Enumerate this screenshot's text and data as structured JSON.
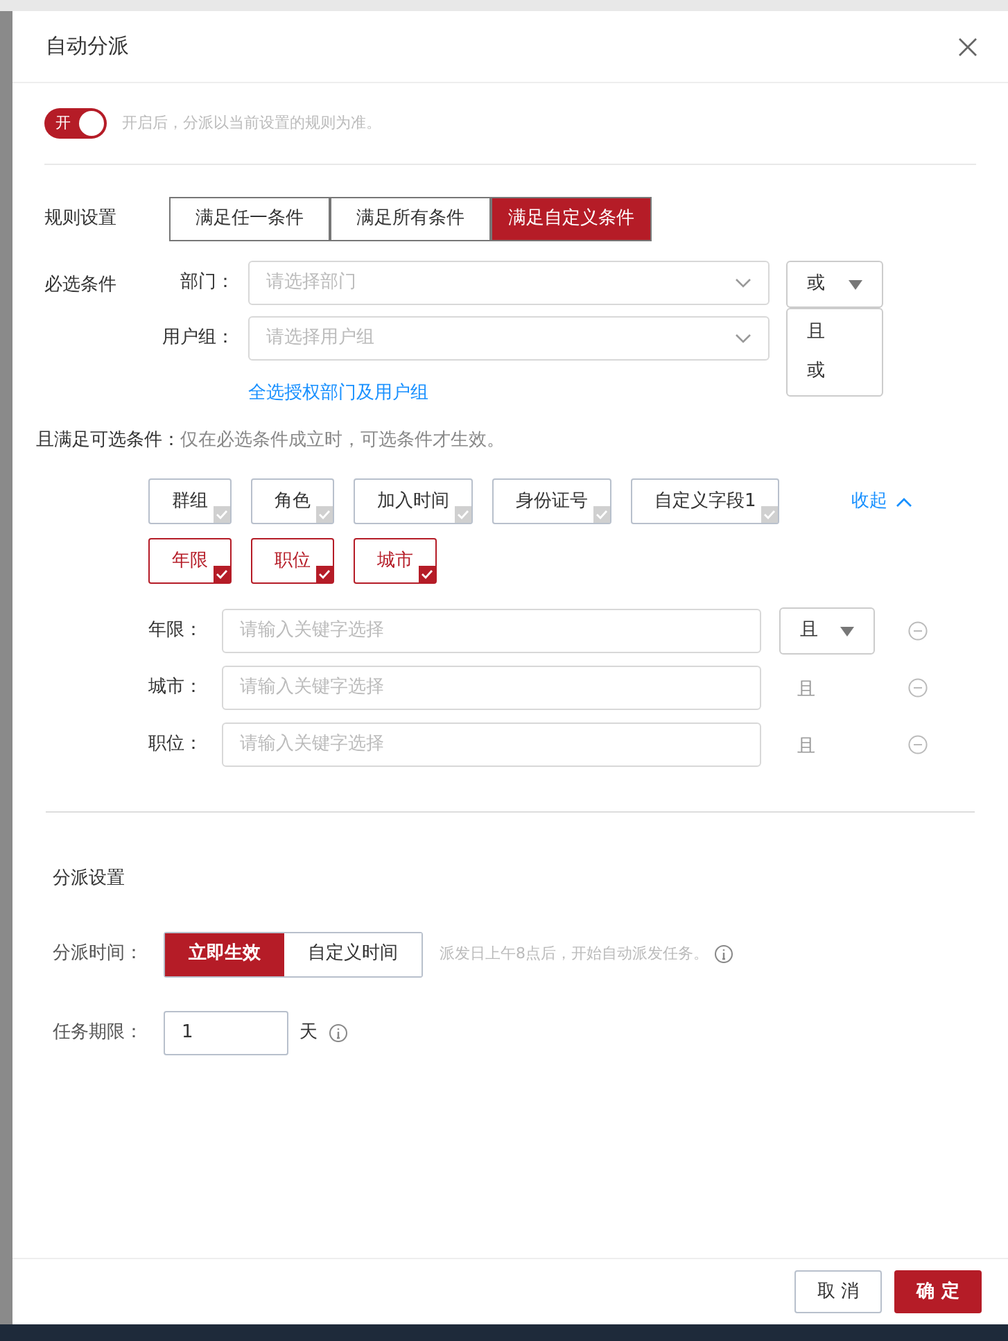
{
  "dialog": {
    "title": "自动分派"
  },
  "toggle": {
    "on": true,
    "label": "开",
    "hint": "开启后，分派以当前设置的规则为准。"
  },
  "rules": {
    "label": "规则设置",
    "options": [
      {
        "label": "满足任一条件",
        "selected": false
      },
      {
        "label": "满足所有条件",
        "selected": false
      },
      {
        "label": "满足自定义条件",
        "selected": true
      }
    ]
  },
  "required": {
    "label": "必选条件",
    "fields": [
      {
        "label": "部门：",
        "placeholder": "请选择部门"
      },
      {
        "label": "用户组：",
        "placeholder": "请选择用户组"
      }
    ],
    "logic": {
      "value": "或",
      "expanded": true,
      "options": [
        "且",
        "或"
      ]
    },
    "link": "全选授权部门及用户组"
  },
  "optional": {
    "label": "且满足可选条件：",
    "hint": "仅在必选条件成立时，可选条件才生效。",
    "collapse": "收起",
    "tags": [
      {
        "label": "群组",
        "checked": false
      },
      {
        "label": "角色",
        "checked": false
      },
      {
        "label": "加入时间",
        "checked": false
      },
      {
        "label": "身份证号",
        "checked": false
      },
      {
        "label": "自定义字段1",
        "checked": false
      },
      {
        "label": "年限",
        "checked": true
      },
      {
        "label": "职位",
        "checked": true
      },
      {
        "label": "城市",
        "checked": true
      }
    ],
    "rows": [
      {
        "label": "年限：",
        "placeholder": "请输入关键字选择",
        "logic": "且",
        "kind": "dropdown"
      },
      {
        "label": "城市：",
        "placeholder": "请输入关键字选择",
        "logic": "且",
        "kind": "text"
      },
      {
        "label": "职位：",
        "placeholder": "请输入关键字选择",
        "logic": "且",
        "kind": "text"
      }
    ]
  },
  "dispatch": {
    "title": "分派设置",
    "time_label": "分派时间：",
    "time_options": [
      {
        "label": "立即生效",
        "selected": true
      },
      {
        "label": "自定义时间",
        "selected": false
      }
    ],
    "time_hint": "派发日上午8点后，开始自动派发任务。",
    "deadline_label": "任务期限：",
    "deadline_value": "1",
    "deadline_unit": "天"
  },
  "footer": {
    "buttons": [
      {
        "label": "取 消",
        "kind": "secondary"
      },
      {
        "label": "确 定",
        "kind": "primary"
      }
    ]
  }
}
